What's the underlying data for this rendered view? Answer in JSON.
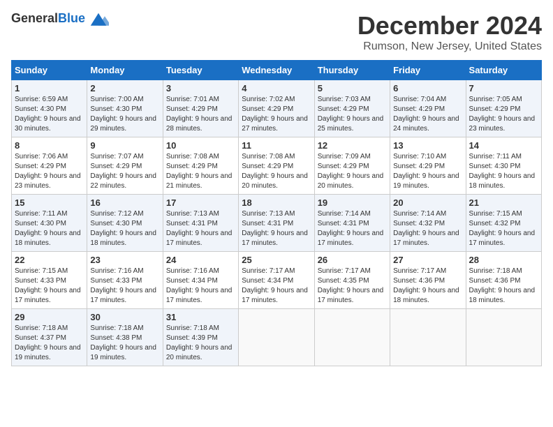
{
  "logo": {
    "general": "General",
    "blue": "Blue"
  },
  "title": "December 2024",
  "location": "Rumson, New Jersey, United States",
  "days_of_week": [
    "Sunday",
    "Monday",
    "Tuesday",
    "Wednesday",
    "Thursday",
    "Friday",
    "Saturday"
  ],
  "weeks": [
    [
      {
        "day": "1",
        "sunrise": "6:59 AM",
        "sunset": "4:30 PM",
        "daylight": "9 hours and 30 minutes."
      },
      {
        "day": "2",
        "sunrise": "7:00 AM",
        "sunset": "4:30 PM",
        "daylight": "9 hours and 29 minutes."
      },
      {
        "day": "3",
        "sunrise": "7:01 AM",
        "sunset": "4:29 PM",
        "daylight": "9 hours and 28 minutes."
      },
      {
        "day": "4",
        "sunrise": "7:02 AM",
        "sunset": "4:29 PM",
        "daylight": "9 hours and 27 minutes."
      },
      {
        "day": "5",
        "sunrise": "7:03 AM",
        "sunset": "4:29 PM",
        "daylight": "9 hours and 25 minutes."
      },
      {
        "day": "6",
        "sunrise": "7:04 AM",
        "sunset": "4:29 PM",
        "daylight": "9 hours and 24 minutes."
      },
      {
        "day": "7",
        "sunrise": "7:05 AM",
        "sunset": "4:29 PM",
        "daylight": "9 hours and 23 minutes."
      }
    ],
    [
      {
        "day": "8",
        "sunrise": "7:06 AM",
        "sunset": "4:29 PM",
        "daylight": "9 hours and 23 minutes."
      },
      {
        "day": "9",
        "sunrise": "7:07 AM",
        "sunset": "4:29 PM",
        "daylight": "9 hours and 22 minutes."
      },
      {
        "day": "10",
        "sunrise": "7:08 AM",
        "sunset": "4:29 PM",
        "daylight": "9 hours and 21 minutes."
      },
      {
        "day": "11",
        "sunrise": "7:08 AM",
        "sunset": "4:29 PM",
        "daylight": "9 hours and 20 minutes."
      },
      {
        "day": "12",
        "sunrise": "7:09 AM",
        "sunset": "4:29 PM",
        "daylight": "9 hours and 20 minutes."
      },
      {
        "day": "13",
        "sunrise": "7:10 AM",
        "sunset": "4:29 PM",
        "daylight": "9 hours and 19 minutes."
      },
      {
        "day": "14",
        "sunrise": "7:11 AM",
        "sunset": "4:30 PM",
        "daylight": "9 hours and 18 minutes."
      }
    ],
    [
      {
        "day": "15",
        "sunrise": "7:11 AM",
        "sunset": "4:30 PM",
        "daylight": "9 hours and 18 minutes."
      },
      {
        "day": "16",
        "sunrise": "7:12 AM",
        "sunset": "4:30 PM",
        "daylight": "9 hours and 18 minutes."
      },
      {
        "day": "17",
        "sunrise": "7:13 AM",
        "sunset": "4:31 PM",
        "daylight": "9 hours and 17 minutes."
      },
      {
        "day": "18",
        "sunrise": "7:13 AM",
        "sunset": "4:31 PM",
        "daylight": "9 hours and 17 minutes."
      },
      {
        "day": "19",
        "sunrise": "7:14 AM",
        "sunset": "4:31 PM",
        "daylight": "9 hours and 17 minutes."
      },
      {
        "day": "20",
        "sunrise": "7:14 AM",
        "sunset": "4:32 PM",
        "daylight": "9 hours and 17 minutes."
      },
      {
        "day": "21",
        "sunrise": "7:15 AM",
        "sunset": "4:32 PM",
        "daylight": "9 hours and 17 minutes."
      }
    ],
    [
      {
        "day": "22",
        "sunrise": "7:15 AM",
        "sunset": "4:33 PM",
        "daylight": "9 hours and 17 minutes."
      },
      {
        "day": "23",
        "sunrise": "7:16 AM",
        "sunset": "4:33 PM",
        "daylight": "9 hours and 17 minutes."
      },
      {
        "day": "24",
        "sunrise": "7:16 AM",
        "sunset": "4:34 PM",
        "daylight": "9 hours and 17 minutes."
      },
      {
        "day": "25",
        "sunrise": "7:17 AM",
        "sunset": "4:34 PM",
        "daylight": "9 hours and 17 minutes."
      },
      {
        "day": "26",
        "sunrise": "7:17 AM",
        "sunset": "4:35 PM",
        "daylight": "9 hours and 17 minutes."
      },
      {
        "day": "27",
        "sunrise": "7:17 AM",
        "sunset": "4:36 PM",
        "daylight": "9 hours and 18 minutes."
      },
      {
        "day": "28",
        "sunrise": "7:18 AM",
        "sunset": "4:36 PM",
        "daylight": "9 hours and 18 minutes."
      }
    ],
    [
      {
        "day": "29",
        "sunrise": "7:18 AM",
        "sunset": "4:37 PM",
        "daylight": "9 hours and 19 minutes."
      },
      {
        "day": "30",
        "sunrise": "7:18 AM",
        "sunset": "4:38 PM",
        "daylight": "9 hours and 19 minutes."
      },
      {
        "day": "31",
        "sunrise": "7:18 AM",
        "sunset": "4:39 PM",
        "daylight": "9 hours and 20 minutes."
      },
      null,
      null,
      null,
      null
    ]
  ],
  "labels": {
    "sunrise_prefix": "Sunrise: ",
    "sunset_prefix": "Sunset: ",
    "daylight_prefix": "Daylight: "
  }
}
